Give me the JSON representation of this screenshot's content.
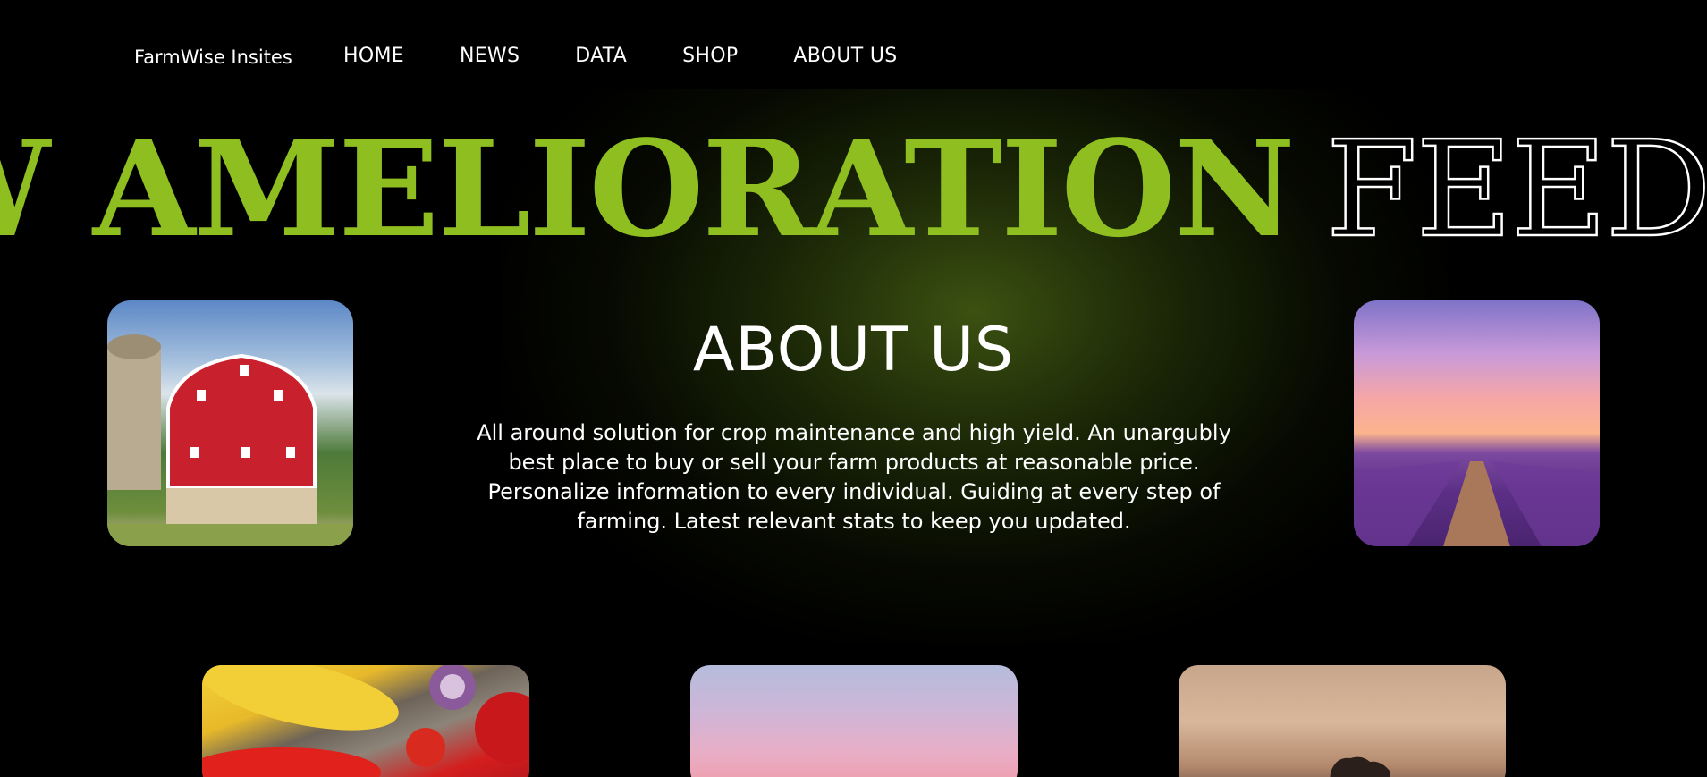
{
  "nav": {
    "brand": "FarmWise Insites",
    "links": [
      "HOME",
      "NEWS",
      "DATA",
      "SHOP",
      "ABOUT US"
    ]
  },
  "marquee": {
    "filled_text": "W AMELIORATION",
    "outlined_text": "FEEDIN",
    "fill_color": "#8fbe21",
    "outline_color": "#ffffff"
  },
  "about": {
    "title": "ABOUT US",
    "description": "All around solution for crop maintenance and high yield. An unargubly best place to buy or sell your farm products at reasonable price. Personalize information to every individual. Guiding at every step of farming. Latest relevant stats to keep you updated."
  },
  "images": {
    "left": "barn-photo",
    "right": "lavender-field-photo"
  },
  "cards": [
    "vegetables-photo",
    "sunset-sky-photo",
    "horse-silhouette-photo"
  ],
  "colors": {
    "background": "#000000",
    "accent": "#8fbe21",
    "text": "#ffffff"
  }
}
